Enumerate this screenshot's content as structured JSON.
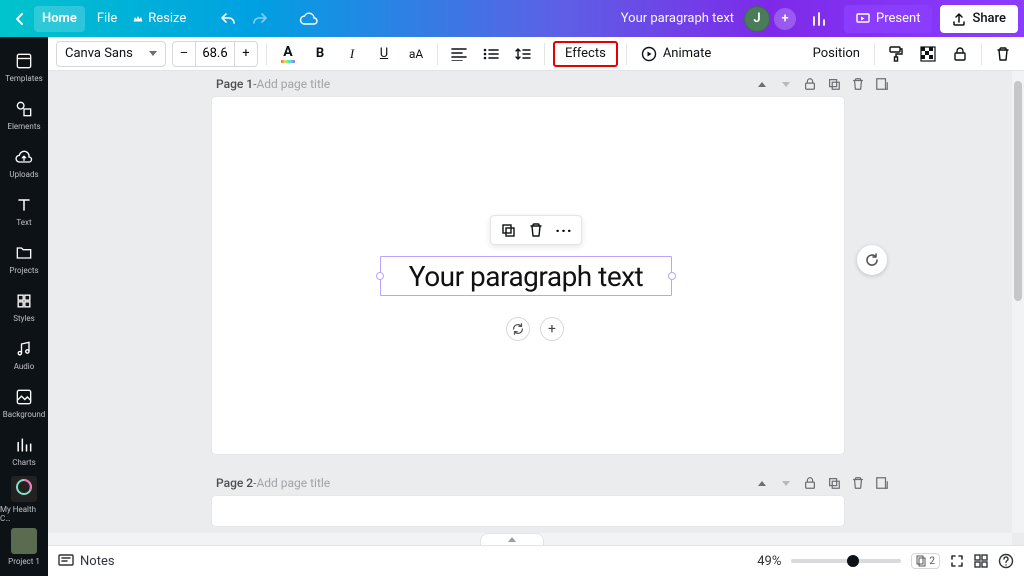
{
  "topbar": {
    "home": "Home",
    "file": "File",
    "resize": "Resize",
    "doc_title": "Your paragraph text",
    "avatar_initial": "J",
    "present": "Present",
    "share": "Share"
  },
  "sidebar": {
    "items": [
      {
        "label": "Templates"
      },
      {
        "label": "Elements"
      },
      {
        "label": "Uploads"
      },
      {
        "label": "Text"
      },
      {
        "label": "Projects"
      },
      {
        "label": "Styles"
      },
      {
        "label": "Audio"
      },
      {
        "label": "Background"
      },
      {
        "label": "Charts"
      },
      {
        "label": "My Health C…"
      },
      {
        "label": "Project 1"
      }
    ]
  },
  "toolbar": {
    "font_name": "Canva Sans",
    "font_size": "68.6",
    "effects": "Effects",
    "animate": "Animate",
    "position": "Position"
  },
  "pages": {
    "p1_prefix": "Page 1",
    "p1_dash": " - ",
    "p1_placeholder": "Add page title",
    "p2_prefix": "Page 2",
    "p2_dash": " - ",
    "p2_placeholder": "Add page title"
  },
  "selection": {
    "text": "Your paragraph text"
  },
  "footer": {
    "notes": "Notes",
    "zoom": "49%",
    "pagechip": "2"
  }
}
